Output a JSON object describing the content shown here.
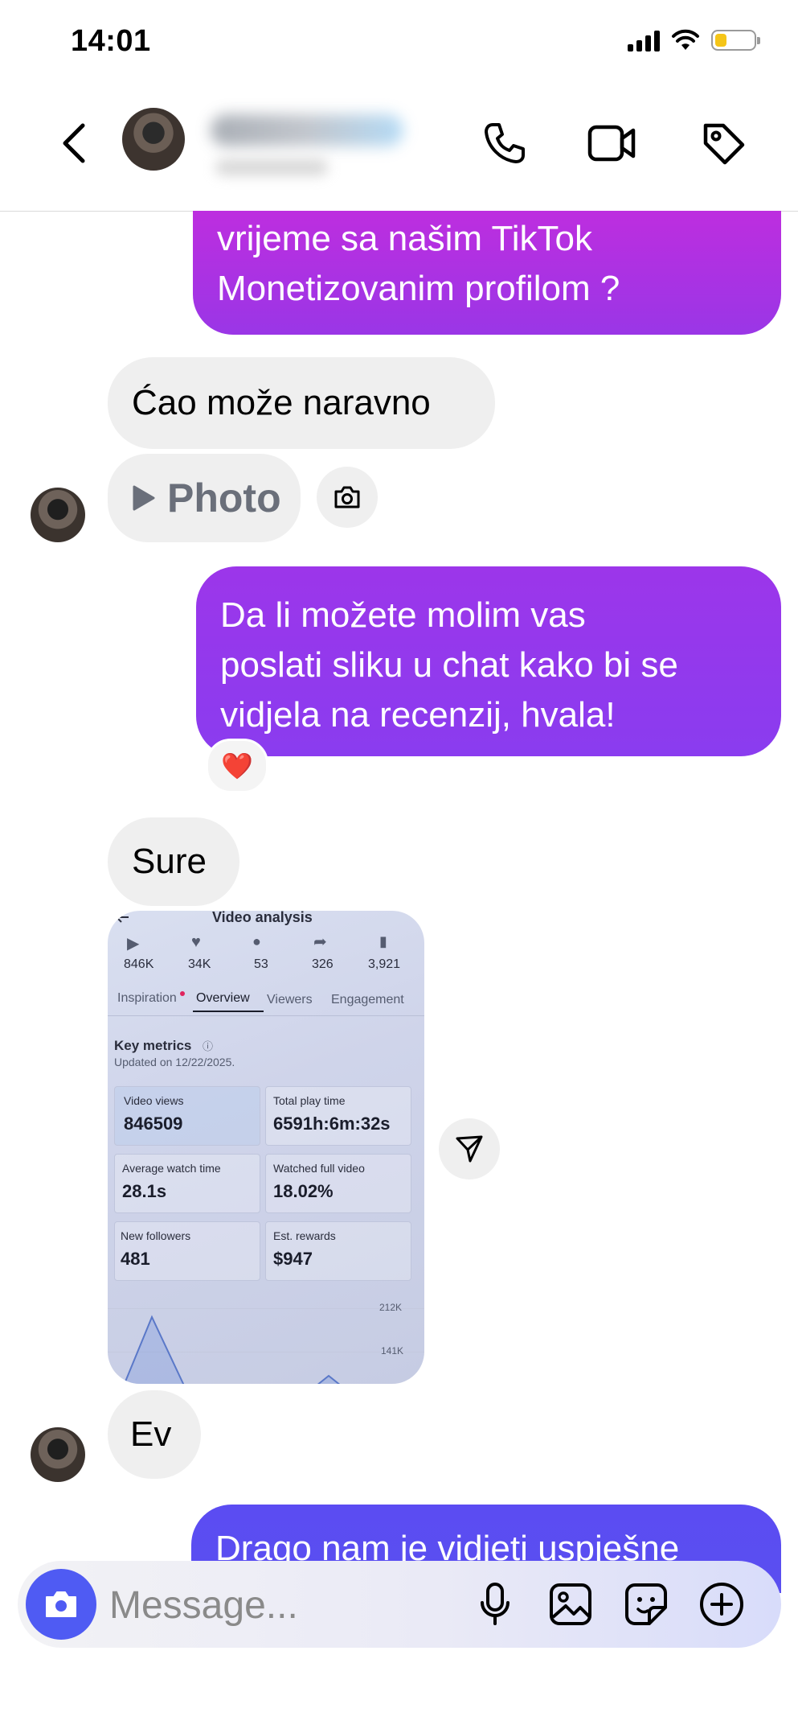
{
  "status_bar": {
    "time": "14:01",
    "battery_level": 0.3,
    "battery_color": "#f5c518"
  },
  "header": {
    "back_icon": "chevron-left-icon",
    "actions": [
      "phone-icon",
      "video-camera-icon",
      "tag-icon"
    ]
  },
  "messages": {
    "m1_line1": "vrijeme sa našim TikTok",
    "m1_line2": "Monetizovanim profilom ?",
    "m2": "Ćao može naravno",
    "m3_label": "Photo",
    "m4_line1": "Da li možete molim vas",
    "m4_line2": "poslati sliku u chat kako bi se",
    "m4_line3": "vidjela na recenzij, hvala!",
    "m4_reaction": "❤️",
    "m5": "Sure",
    "m7": "Ev",
    "m8_partial": "Drago nam je vidjeti uspješne"
  },
  "shared_image": {
    "title": "Video analysis",
    "stats": [
      "846K",
      "34K",
      "53",
      "326",
      "3,921"
    ],
    "tabs": [
      "Inspiration",
      "Overview",
      "Viewers",
      "Engagement"
    ],
    "key_metrics_title": "Key metrics",
    "updated": "Updated on 12/22/2025.",
    "metrics": [
      {
        "label": "Video views",
        "value": "846509"
      },
      {
        "label": "Total play time",
        "value": "6591h:6m:32s"
      },
      {
        "label": "Average watch time",
        "value": "28.1s"
      },
      {
        "label": "Watched full video",
        "value": "18.02%"
      },
      {
        "label": "New followers",
        "value": "481"
      },
      {
        "label": "Est. rewards",
        "value": "$947"
      }
    ],
    "axis": [
      "212K",
      "141K"
    ]
  },
  "composer": {
    "placeholder": "Message..."
  },
  "colors": {
    "out_bubble_top": "#b82fe0",
    "out_bubble_mid": "#8a3cef",
    "out_bubble_bottom": "#5b4cf2",
    "in_bubble": "#efefef",
    "accent": "#4f5bf3"
  }
}
